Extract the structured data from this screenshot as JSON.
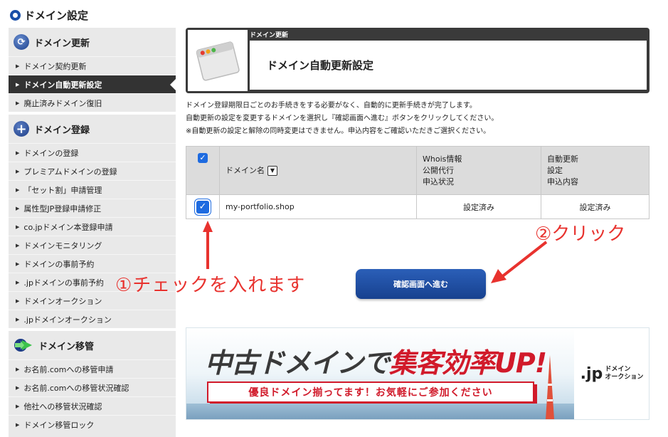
{
  "page": {
    "title": "ドメイン設定"
  },
  "sidebar": {
    "sections": [
      {
        "label": "ドメイン更新",
        "icon": "refresh-icon",
        "items": [
          {
            "label": "ドメイン契約更新",
            "active": false
          },
          {
            "label": "ドメイン自動更新設定",
            "active": true
          },
          {
            "label": "廃止済みドメイン復旧",
            "active": false
          }
        ]
      },
      {
        "label": "ドメイン登録",
        "icon": "plus-icon",
        "items": [
          {
            "label": "ドメインの登録"
          },
          {
            "label": "プレミアムドメインの登録"
          },
          {
            "label": "「セット割」申請管理"
          },
          {
            "label": "属性型JP登録申請修正"
          },
          {
            "label": "co.jpドメイン本登録申請"
          },
          {
            "label": "ドメインモニタリング"
          },
          {
            "label": "ドメインの事前予約"
          },
          {
            "label": ".jpドメインの事前予約"
          },
          {
            "label": "ドメインオークション"
          },
          {
            "label": ".jpドメインオークション"
          }
        ]
      },
      {
        "label": "ドメイン移管",
        "icon": "transfer-icon",
        "items": [
          {
            "label": "お名前.comへの移管申請"
          },
          {
            "label": "お名前.comへの移管状況確認"
          },
          {
            "label": "他社への移管状況確認"
          },
          {
            "label": "ドメイン移管ロック"
          }
        ]
      }
    ]
  },
  "header": {
    "category": "ドメイン更新",
    "title": "ドメイン自動更新設定"
  },
  "description": {
    "line1": "ドメイン登録期限日ごとのお手続きをする必要がなく、自動的に更新手続きが完了します。",
    "line2": "自動更新の設定を変更するドメインを選択し『確認画面へ進む』ボタンをクリックしてください。",
    "line3": "※自動更新の設定と解除の同時変更はできません。申込内容をご確認いただきご選択ください。"
  },
  "table": {
    "headers": {
      "domain": "ドメイン名",
      "whois_1": "Whois情報",
      "whois_2": "公開代行",
      "whois_3": "申込状況",
      "auto_1": "自動更新",
      "auto_2": "設定",
      "auto_3": "申込内容"
    },
    "rows": [
      {
        "domain": "my-portfolio.shop",
        "whois": "設定済み",
        "auto": "設定済み",
        "checked": true
      }
    ]
  },
  "annotations": {
    "check": "①チェックを入れます",
    "click": "②クリック",
    "color": "#e8322e"
  },
  "buttons": {
    "confirm": "確認画面へ進む"
  },
  "banner": {
    "main_prefix": "中古ドメインで",
    "main_highlight": "集客効率UP!",
    "sub": "優良ドメイン揃ってます！お気軽にご参加ください",
    "logo_jp": ".jp",
    "logo_line1": "ドメイン",
    "logo_line2": "オークション"
  },
  "colors": {
    "accent": "#1a4fa8",
    "checkbox": "#1e6be0",
    "banner_red": "#d11a2a"
  }
}
